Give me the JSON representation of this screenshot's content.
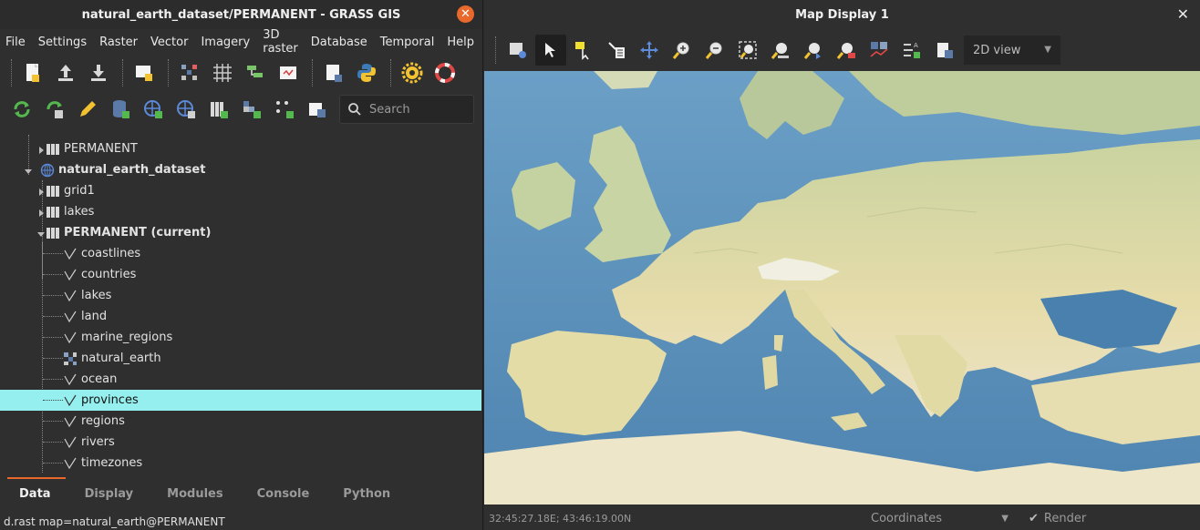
{
  "left_window": {
    "title": "natural_earth_dataset/PERMANENT - GRASS GIS",
    "close": "✕",
    "menu": [
      "File",
      "Settings",
      "Raster",
      "Vector",
      "Imagery",
      "3D raster",
      "Database",
      "Temporal",
      "Help"
    ],
    "search_placeholder": "Search",
    "tree": [
      {
        "label": "PERMANENT",
        "indent": 1,
        "icon": "mapset-icon",
        "bold": false
      },
      {
        "label": "natural_earth_dataset",
        "indent": 0,
        "icon": "globe-icon",
        "bold": true
      },
      {
        "label": "grid1",
        "indent": 1,
        "icon": "mapset-icon",
        "bold": false
      },
      {
        "label": "lakes",
        "indent": 1,
        "icon": "mapset-icon",
        "bold": false
      },
      {
        "label": "PERMANENT  (current)",
        "indent": 1,
        "icon": "mapset-icon",
        "bold": true
      },
      {
        "label": "coastlines",
        "indent": 2,
        "icon": "vector-icon"
      },
      {
        "label": "countries",
        "indent": 2,
        "icon": "vector-icon"
      },
      {
        "label": "lakes",
        "indent": 2,
        "icon": "vector-icon"
      },
      {
        "label": "land",
        "indent": 2,
        "icon": "vector-icon"
      },
      {
        "label": "marine_regions",
        "indent": 2,
        "icon": "vector-icon"
      },
      {
        "label": "natural_earth",
        "indent": 2,
        "icon": "raster-icon"
      },
      {
        "label": "ocean",
        "indent": 2,
        "icon": "vector-icon"
      },
      {
        "label": "provinces",
        "indent": 2,
        "icon": "vector-icon",
        "selected": true
      },
      {
        "label": "regions",
        "indent": 2,
        "icon": "vector-icon"
      },
      {
        "label": "rivers",
        "indent": 2,
        "icon": "vector-icon"
      },
      {
        "label": "timezones",
        "indent": 2,
        "icon": "vector-icon"
      }
    ],
    "tabs": [
      "Data",
      "Display",
      "Modules",
      "Console",
      "Python"
    ],
    "active_tab": "Data",
    "status": "d.rast map=natural_earth@PERMANENT"
  },
  "right_window": {
    "title": "Map Display 1",
    "close": "✕",
    "view_mode": "2D view",
    "coordinates": "32:45:27.18E; 43:46:19.00N",
    "coord_mode": "Coordinates",
    "render_label": "Render"
  },
  "colors": {
    "accent": "#e8692b",
    "selection": "#95efef",
    "sea": "#5b90b8",
    "land": "#e3dba9"
  }
}
